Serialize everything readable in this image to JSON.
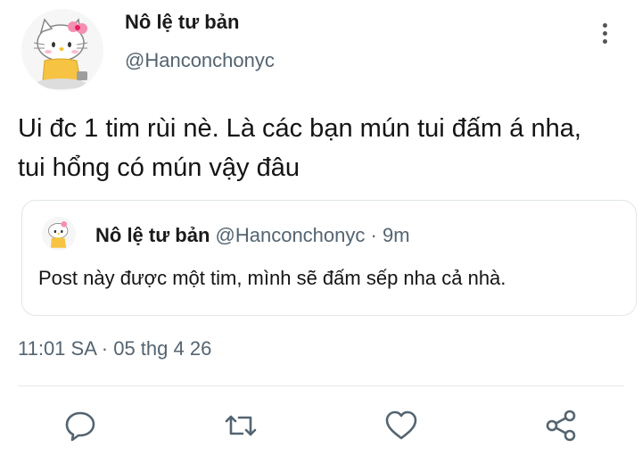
{
  "tweet": {
    "author_name": "Nô lệ tư bản",
    "author_handle": "@Hanconchonyc",
    "text": "Ui đc 1 tim rùi nè. Là các bạn mún tui đấm á nha, tui hổng có mún vậy đâu",
    "timestamp": "11:01 SA · 05 thg 4 26"
  },
  "quoted_tweet": {
    "author_name": "Nô lệ tư bản",
    "author_handle": "@Hanconchonyc",
    "separator": "·",
    "time": "9m",
    "text": "Post này được một tim, mình sẽ đấm sếp nha cả nhà."
  },
  "actions": [
    {
      "icon": "reply-icon"
    },
    {
      "icon": "retweet-icon"
    },
    {
      "icon": "like-icon"
    },
    {
      "icon": "share-icon"
    }
  ],
  "colors": {
    "text": "#141414",
    "secondary": "#536471",
    "icon": "#536471",
    "border": "#e1e6ea"
  }
}
